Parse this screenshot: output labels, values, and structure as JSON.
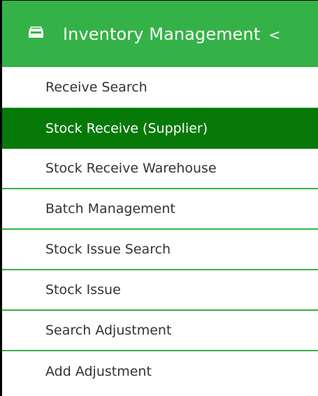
{
  "colors": {
    "header_bg": "#35b247",
    "active_bg": "#077908",
    "divider": "#35b247",
    "text": "#333333"
  },
  "header": {
    "icon": "inbox-tray-icon",
    "title": "Inventory Management",
    "toggle": "<"
  },
  "items": [
    {
      "label": "Receive Search",
      "active": false
    },
    {
      "label": "Stock Receive (Supplier)",
      "active": true
    },
    {
      "label": "Stock Receive Warehouse",
      "active": false
    },
    {
      "label": "Batch Management",
      "active": false
    },
    {
      "label": "Stock Issue Search",
      "active": false
    },
    {
      "label": "Stock Issue",
      "active": false
    },
    {
      "label": "Search Adjustment",
      "active": false
    },
    {
      "label": "Add Adjustment",
      "active": false
    }
  ]
}
